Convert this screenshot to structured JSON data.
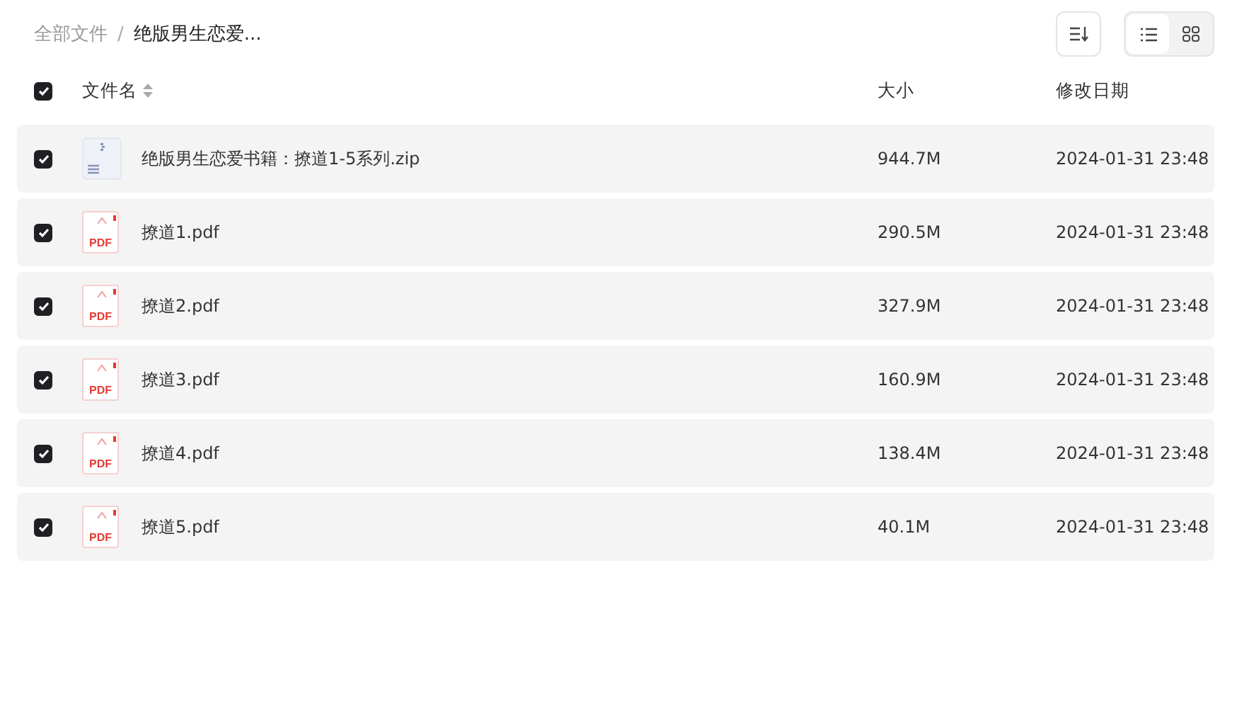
{
  "breadcrumb": [
    {
      "label": "全部文件",
      "current": false
    },
    {
      "label": "绝版男生恋爱...",
      "current": true
    }
  ],
  "breadcrumb_separator": "/",
  "view_modes": [
    {
      "kind": "list",
      "selected": true
    },
    {
      "kind": "grid",
      "selected": false
    }
  ],
  "header": {
    "checked": true,
    "name": "文件名",
    "size": "大小",
    "date": "修改日期"
  },
  "rows": [
    {
      "kind": "zip",
      "checked": true,
      "name": "绝版男生恋爱书籍：撩道1-5系列.zip",
      "size": "944.7M",
      "date": "2024-01-31 23:48"
    },
    {
      "kind": "pdf",
      "icon_text": "PDF",
      "checked": true,
      "name": "撩道1.pdf",
      "size": "290.5M",
      "date": "2024-01-31 23:48"
    },
    {
      "kind": "pdf",
      "icon_text": "PDF",
      "checked": true,
      "name": "撩道2.pdf",
      "size": "327.9M",
      "date": "2024-01-31 23:48"
    },
    {
      "kind": "pdf",
      "icon_text": "PDF",
      "checked": true,
      "name": "撩道3.pdf",
      "size": "160.9M",
      "date": "2024-01-31 23:48"
    },
    {
      "kind": "pdf",
      "icon_text": "PDF",
      "checked": true,
      "name": "撩道4.pdf",
      "size": "138.4M",
      "date": "2024-01-31 23:48"
    },
    {
      "kind": "pdf",
      "icon_text": "PDF",
      "checked": true,
      "name": "撩道5.pdf",
      "size": "40.1M",
      "date": "2024-01-31 23:48"
    }
  ]
}
